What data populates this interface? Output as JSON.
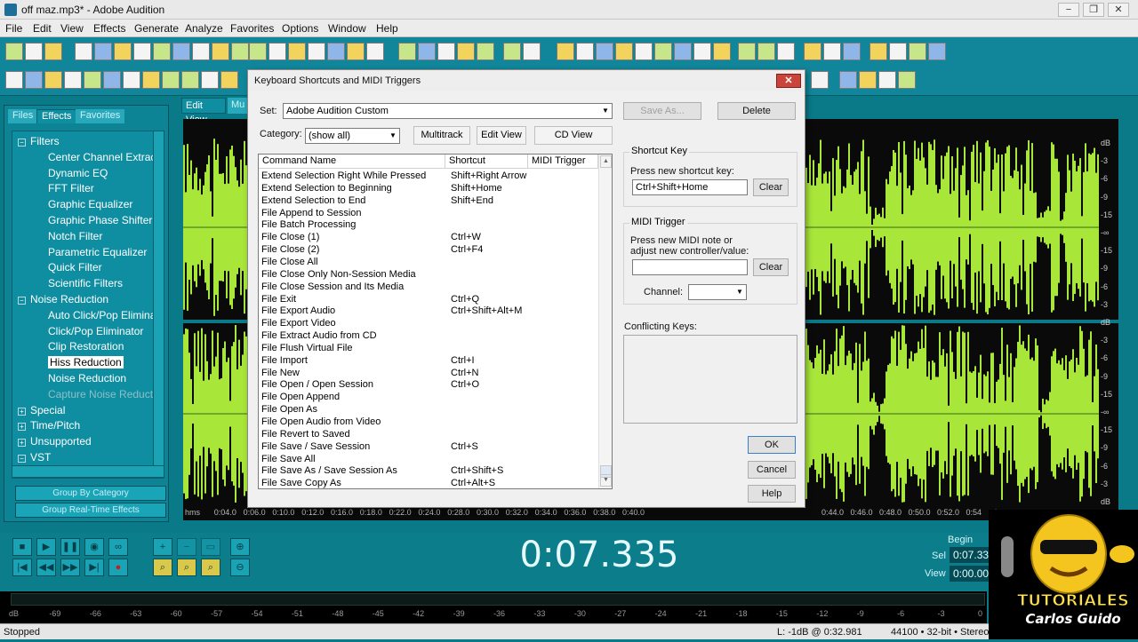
{
  "window": {
    "title": "off maz.mp3* - Adobe Audition",
    "controls": [
      "−",
      "❐",
      "✕"
    ]
  },
  "menu": [
    "File",
    "Edit",
    "View",
    "Effects",
    "Generate",
    "Analyze",
    "Favorites",
    "Options",
    "Window",
    "Help"
  ],
  "left_panel": {
    "tabs": [
      "Files",
      "Effects",
      "Favorites"
    ],
    "tree": [
      {
        "label": "Filters",
        "level": 0,
        "expander": "−"
      },
      {
        "label": "Center Channel Extracto",
        "level": 1
      },
      {
        "label": "Dynamic EQ",
        "level": 1
      },
      {
        "label": "FFT Filter",
        "level": 1
      },
      {
        "label": "Graphic Equalizer",
        "level": 1
      },
      {
        "label": "Graphic Phase Shifter",
        "level": 1
      },
      {
        "label": "Notch Filter",
        "level": 1
      },
      {
        "label": "Parametric Equalizer",
        "level": 1
      },
      {
        "label": "Quick Filter",
        "level": 1
      },
      {
        "label": "Scientific Filters",
        "level": 1
      },
      {
        "label": "Noise Reduction",
        "level": 0,
        "expander": "−"
      },
      {
        "label": "Auto Click/Pop Elimina",
        "level": 1
      },
      {
        "label": "Click/Pop Eliminator",
        "level": 1
      },
      {
        "label": "Clip Restoration",
        "level": 1
      },
      {
        "label": "Hiss Reduction",
        "level": 1,
        "selected": true
      },
      {
        "label": "Noise Reduction",
        "level": 1
      },
      {
        "label": "Capture Noise Reductio",
        "level": 1,
        "dim": true
      },
      {
        "label": "Special",
        "level": 0,
        "expander": "+"
      },
      {
        "label": "Time/Pitch",
        "level": 0,
        "expander": "+"
      },
      {
        "label": "Unsupported",
        "level": 0,
        "expander": "+"
      },
      {
        "label": "VST",
        "level": 0,
        "expander": "−"
      }
    ],
    "group_by_category": "Group By Category",
    "group_realtime": "Group Real-Time Effects"
  },
  "view_tabs": [
    "Edit View",
    "Mu"
  ],
  "db_scale": [
    "dB",
    "-3",
    "-6",
    "-9",
    "-15",
    "-∞",
    "-15",
    "-9",
    "-6",
    "-3",
    "dB",
    "-3",
    "-6",
    "-9",
    "-15",
    "-∞",
    "-15",
    "-9",
    "-6",
    "-3",
    "dB"
  ],
  "timeline": {
    "left": [
      "hms",
      "0:04.0",
      "0:06.0",
      "0:10.0",
      "0:12.0",
      "0:16.0",
      "0:18.0",
      "0:22.0",
      "0:24.0",
      "0:28.0",
      "0:30.0",
      "0:32.0",
      "0:34.0",
      "0:36.0",
      "0:38.0",
      "0:40.0"
    ],
    "right": [
      "0:44.0",
      "0:46.0",
      "0:48.0",
      "0:50.0",
      "0:52.0",
      "0:54",
      "hms"
    ]
  },
  "transport": {
    "time": "0:07.335",
    "begin_label": "Begin",
    "sel_label": "Sel",
    "sel_value": "0:07.33",
    "view_label": "View",
    "view_value": "0:00.00"
  },
  "meter_scale": [
    "dB",
    "-69",
    "-66",
    "-63",
    "-60",
    "-57",
    "-54",
    "-51",
    "-48",
    "-45",
    "-42",
    "-39",
    "-36",
    "-33",
    "-30",
    "-27",
    "-24",
    "-21",
    "-18",
    "-15",
    "-12",
    "-9",
    "-6",
    "-3",
    "0"
  ],
  "status": {
    "left": "Stopped",
    "level": "L: -1dB @  0:32.981",
    "format": "44100 • 32-bit • Stereo"
  },
  "dialog": {
    "title": "Keyboard Shortcuts and MIDI Triggers",
    "set_label": "Set:",
    "set_value": "Adobe Audition Custom",
    "save_as": "Save As...",
    "delete": "Delete",
    "category_label": "Category:",
    "category_value": "(show all)",
    "views": [
      "Multitrack",
      "Edit View",
      "CD View"
    ],
    "columns": [
      "Command Name",
      "Shortcut",
      "MIDI Trigger"
    ],
    "commands": [
      {
        "name": "Extend Selection Right While Pressed",
        "shortcut": "Shift+Right Arrow"
      },
      {
        "name": "Extend Selection to Beginning",
        "shortcut": "Shift+Home"
      },
      {
        "name": "Extend Selection to End",
        "shortcut": "Shift+End"
      },
      {
        "name": "File Append to Session",
        "shortcut": ""
      },
      {
        "name": "File Batch Processing",
        "shortcut": ""
      },
      {
        "name": "File Close (1)",
        "shortcut": "Ctrl+W"
      },
      {
        "name": "File Close (2)",
        "shortcut": "Ctrl+F4"
      },
      {
        "name": "File Close All",
        "shortcut": ""
      },
      {
        "name": "File Close Only Non-Session Media",
        "shortcut": ""
      },
      {
        "name": "File Close Session and Its Media",
        "shortcut": ""
      },
      {
        "name": "File Exit",
        "shortcut": "Ctrl+Q"
      },
      {
        "name": "File Export Audio",
        "shortcut": "Ctrl+Shift+Alt+M"
      },
      {
        "name": "File Export Video",
        "shortcut": ""
      },
      {
        "name": "File Extract Audio from CD",
        "shortcut": ""
      },
      {
        "name": "File Flush Virtual File",
        "shortcut": ""
      },
      {
        "name": "File Import",
        "shortcut": "Ctrl+I"
      },
      {
        "name": "File New",
        "shortcut": "Ctrl+N"
      },
      {
        "name": "File Open / Open Session",
        "shortcut": "Ctrl+O"
      },
      {
        "name": "File Open Append",
        "shortcut": ""
      },
      {
        "name": "File Open As",
        "shortcut": ""
      },
      {
        "name": "File Open Audio from Video",
        "shortcut": ""
      },
      {
        "name": "File Revert to Saved",
        "shortcut": ""
      },
      {
        "name": "File Save / Save Session",
        "shortcut": "Ctrl+S"
      },
      {
        "name": "File Save All",
        "shortcut": ""
      },
      {
        "name": "File Save As / Save Session As",
        "shortcut": "Ctrl+Shift+S"
      },
      {
        "name": "File Save Copy As",
        "shortcut": "Ctrl+Alt+S"
      }
    ],
    "shortcut_group": "Shortcut Key",
    "press_shortcut": "Press new shortcut key:",
    "shortcut_value": "Ctrl+Shift+Home",
    "clear": "Clear",
    "midi_group": "MIDI Trigger",
    "press_midi_1": "Press new MIDI note or",
    "press_midi_2": "adjust new controller/value:",
    "channel_label": "Channel:",
    "conflicting_label": "Conflicting Keys:",
    "ok": "OK",
    "cancel": "Cancel",
    "help": "Help"
  },
  "logo": {
    "line1": "TUTORIALES",
    "line2": "Carlos Guido"
  },
  "colors": {
    "waveform": "#a8e63a",
    "app_bg": "#0b7a88"
  }
}
